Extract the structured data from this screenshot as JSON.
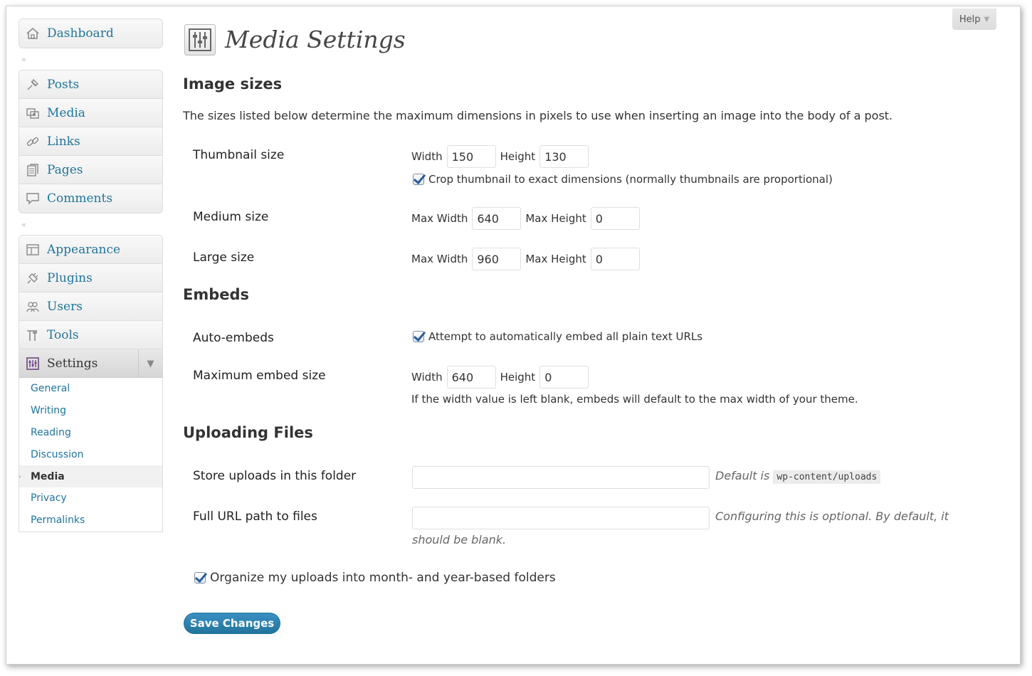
{
  "sidebar": {
    "top": {
      "label": "Dashboard",
      "icon": "dashboard-icon"
    },
    "separator_icon": "«",
    "group1": [
      {
        "label": "Posts",
        "icon": "pushpin-icon"
      },
      {
        "label": "Media",
        "icon": "media-icon"
      },
      {
        "label": "Links",
        "icon": "links-icon"
      },
      {
        "label": "Pages",
        "icon": "pages-icon"
      },
      {
        "label": "Comments",
        "icon": "comments-icon"
      }
    ],
    "group2": [
      {
        "label": "Appearance",
        "icon": "appearance-icon"
      },
      {
        "label": "Plugins",
        "icon": "plugins-icon"
      },
      {
        "label": "Users",
        "icon": "users-icon"
      },
      {
        "label": "Tools",
        "icon": "tools-icon"
      }
    ],
    "settings": {
      "label": "Settings",
      "icon": "settings-icon",
      "submenu": [
        "General",
        "Writing",
        "Reading",
        "Discussion",
        "Media",
        "Privacy",
        "Permalinks"
      ],
      "current": "Media"
    }
  },
  "help": {
    "label": "Help",
    "arrow": "▼"
  },
  "page": {
    "title": "Media Settings"
  },
  "image_sizes": {
    "heading": "Image sizes",
    "description": "The sizes listed below determine the maximum dimensions in pixels to use when inserting an image into the body of a post.",
    "thumbnail": {
      "label": "Thumbnail size",
      "width_label": "Width",
      "width": "150",
      "height_label": "Height",
      "height": "130",
      "crop_label": "Crop thumbnail to exact dimensions (normally thumbnails are proportional)",
      "crop_checked": true
    },
    "medium": {
      "label": "Medium size",
      "width_label": "Max Width",
      "width": "640",
      "height_label": "Max Height",
      "height": "0"
    },
    "large": {
      "label": "Large size",
      "width_label": "Max Width",
      "width": "960",
      "height_label": "Max Height",
      "height": "0"
    }
  },
  "embeds": {
    "heading": "Embeds",
    "auto": {
      "label": "Auto-embeds",
      "checkbox_label": "Attempt to automatically embed all plain text URLs",
      "checked": true
    },
    "max_size": {
      "label": "Maximum embed size",
      "width_label": "Width",
      "width": "640",
      "height_label": "Height",
      "height": "0",
      "note": "If the width value is left blank, embeds will default to the max width of your theme."
    }
  },
  "uploading": {
    "heading": "Uploading Files",
    "store": {
      "label": "Store uploads in this folder",
      "value": "",
      "hint_prefix": "Default is",
      "hint_code": "wp-content/uploads"
    },
    "url": {
      "label": "Full URL path to files",
      "value": "",
      "hint_line1": "Configuring this is optional. By default, it",
      "hint_line2": "should be blank."
    },
    "organize": {
      "label": "Organize my uploads into month- and year-based folders",
      "checked": true
    }
  },
  "save_button": "Save Changes",
  "colors": {
    "link": "#21759b",
    "button": "#21759b"
  }
}
